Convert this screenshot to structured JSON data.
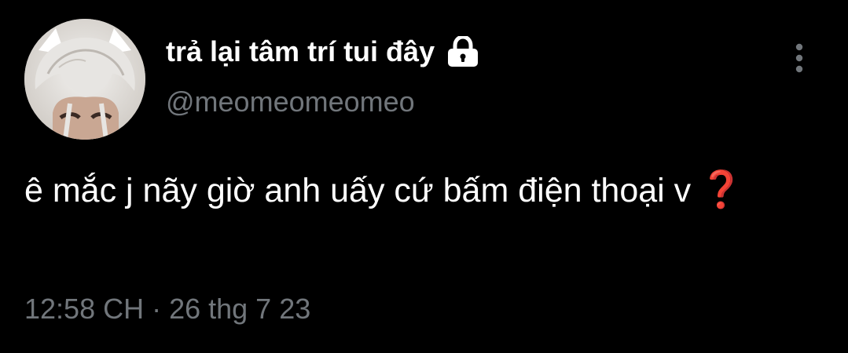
{
  "author": {
    "display_name": "trả lại tâm trí tui đây",
    "handle": "@meomeomeomeo",
    "avatar_icon": "avatar-photo",
    "lock_icon": "lock-icon"
  },
  "tweet": {
    "text": "ê mắc j nãy giờ anh uấy cứ bấm điện thoại v",
    "emoji": "❓",
    "timestamp": "12:58 CH · 26 thg 7 23"
  },
  "menu": {
    "icon": "more-vertical-icon"
  },
  "colors": {
    "background": "#000000",
    "text": "#ffffff",
    "secondary_text": "#71767b",
    "emoji_red": "#e0161d"
  }
}
